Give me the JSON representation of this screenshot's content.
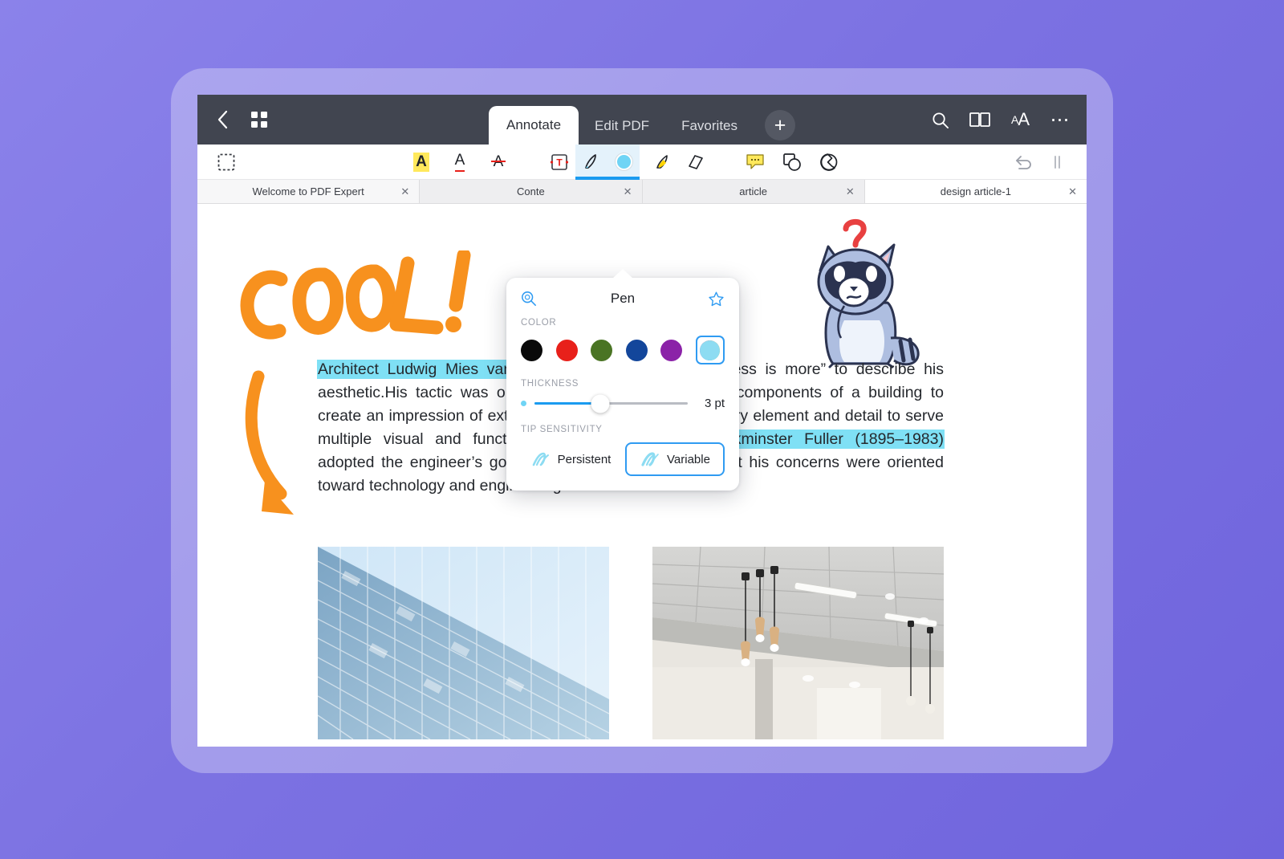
{
  "app": {
    "name": "PDF Expert",
    "accent_blue": "#1a9bf0",
    "topbar_bg": "#414550",
    "background_purple": "#7c72e2"
  },
  "topbar": {
    "back_icon": "back-chevron-icon",
    "grid_icon": "thumbnail-grid-icon",
    "tabs": [
      {
        "label": "Annotate",
        "active": true
      },
      {
        "label": "Edit PDF",
        "active": false
      },
      {
        "label": "Favorites",
        "active": false
      }
    ],
    "add_tab_label": "+",
    "right_icons": [
      {
        "name": "search-icon",
        "glyph": "search"
      },
      {
        "name": "book-reading-mode-icon",
        "glyph": "book"
      },
      {
        "name": "font-size-icon",
        "glyph": "aA"
      },
      {
        "name": "more-options-icon",
        "glyph": "•••"
      }
    ]
  },
  "annotate_toolbar": {
    "select_tool": "selection-marquee-icon",
    "text_tools": [
      {
        "name": "highlight-text-icon",
        "label": "A"
      },
      {
        "name": "underline-text-icon",
        "label": "A"
      },
      {
        "name": "strikethrough-text-icon",
        "label": "A"
      }
    ],
    "draw_tools": [
      {
        "name": "text-box-icon",
        "label": "T",
        "active": false
      },
      {
        "name": "pen-icon",
        "label": "Pen",
        "active": true
      },
      {
        "name": "pen-color-swatch",
        "label": "",
        "active": true
      },
      {
        "name": "highlighter-icon",
        "label": "Highlighter",
        "active": false
      },
      {
        "name": "eraser-icon",
        "label": "Eraser",
        "active": false
      }
    ],
    "shape_tools": [
      {
        "name": "note-comment-icon",
        "label": "Note"
      },
      {
        "name": "shapes-icon",
        "label": "Shapes"
      },
      {
        "name": "stamp-sticker-icon",
        "label": "Stamp"
      }
    ],
    "undo_icon": "undo-arrow-icon"
  },
  "doc_tabs": [
    {
      "label": "Welcome to PDF Expert",
      "closable": true,
      "active": false
    },
    {
      "label": "Conte",
      "closable": true,
      "active": false
    },
    {
      "label": "article",
      "closable": true,
      "active": false
    },
    {
      "label": "design article-1",
      "closable": true,
      "active": true
    }
  ],
  "pen_popup": {
    "loupe_icon": "magnifier-loupe-icon",
    "title": "Pen",
    "favorite_icon": "star-favorite-icon",
    "color_label": "COLOR",
    "colors": [
      {
        "name": "color-black",
        "hex": "#0a0a0a",
        "selected": false
      },
      {
        "name": "color-red",
        "hex": "#e8201a",
        "selected": false
      },
      {
        "name": "color-green",
        "hex": "#4a7424",
        "selected": false
      },
      {
        "name": "color-blue",
        "hex": "#13469b",
        "selected": false
      },
      {
        "name": "color-purple",
        "hex": "#8b22a8",
        "selected": false
      }
    ],
    "custom_color": {
      "name": "color-custom-picker",
      "hex": "#8ddcf2",
      "selected": true
    },
    "thickness_label": "THICKNESS",
    "thickness_value": "3 pt",
    "thickness_percent": 43,
    "tip_label": "TIP SENSITIVITY",
    "tip_options": [
      {
        "name": "tip-persistent",
        "label": "Persistent",
        "selected": false
      },
      {
        "name": "tip-variable",
        "label": "Variable",
        "selected": true
      }
    ]
  },
  "document": {
    "annotations": {
      "cool_text": "COOL!",
      "cool_color": "#f7911e",
      "arrow_color": "#f7911e",
      "sticker": "thinking-raccoon-sticker",
      "sticker_mark": "?"
    },
    "paragraph": {
      "highlight_1": "Architect Ludwig Mies van der Rohe used",
      "text_1": " the motto “Less is more” to describe his aesthetic.His tactic was one of arranging the necessary components of a building to create an impression of extreme simplicity—he enlisted every element and detail to serve multiple visual and functional purposes. ",
      "highlight_2": "Designer Buckminster Fuller (1895–1983)",
      "text_2": " adopted the engineer’s goal of “Doing more with less”, but his concerns were oriented toward technology and engineering rather than aesthetics.",
      "highlight_color": "#7fe0f5"
    },
    "images": [
      {
        "name": "photo-glass-facade-building",
        "alt": "glass facade building against blue sky"
      },
      {
        "name": "photo-concrete-ceiling-pendant-lights",
        "alt": "concrete ceiling with pendant lights"
      }
    ]
  }
}
